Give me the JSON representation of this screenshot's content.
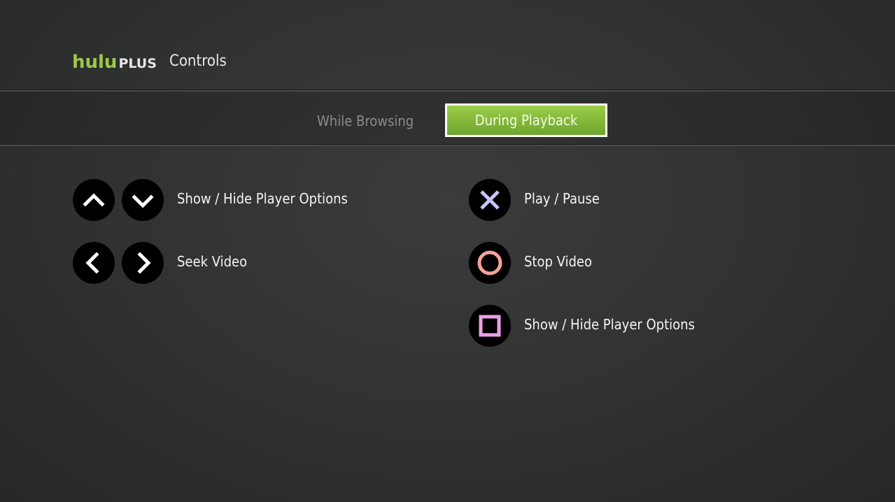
{
  "header": {
    "logo_primary": "hulu",
    "logo_secondary": "PLUS",
    "title": "Controls"
  },
  "tabs": [
    {
      "label": "While Browsing",
      "selected": false
    },
    {
      "label": "During Playback",
      "selected": true
    }
  ],
  "colors": {
    "brand_green": "#9dc84b",
    "cross": "#c7c6f5",
    "circle": "#f2a49a",
    "square": "#eaa0e6"
  },
  "controls_left": [
    {
      "icons": [
        "arrow-up-icon",
        "arrow-down-icon"
      ],
      "label": "Show / Hide Player Options"
    },
    {
      "icons": [
        "arrow-left-icon",
        "arrow-right-icon"
      ],
      "label": "Seek Video"
    }
  ],
  "controls_right": [
    {
      "icon": "cross-button-icon",
      "label": "Play / Pause"
    },
    {
      "icon": "circle-button-icon",
      "label": "Stop Video"
    },
    {
      "icon": "square-button-icon",
      "label": "Show / Hide Player Options"
    }
  ]
}
